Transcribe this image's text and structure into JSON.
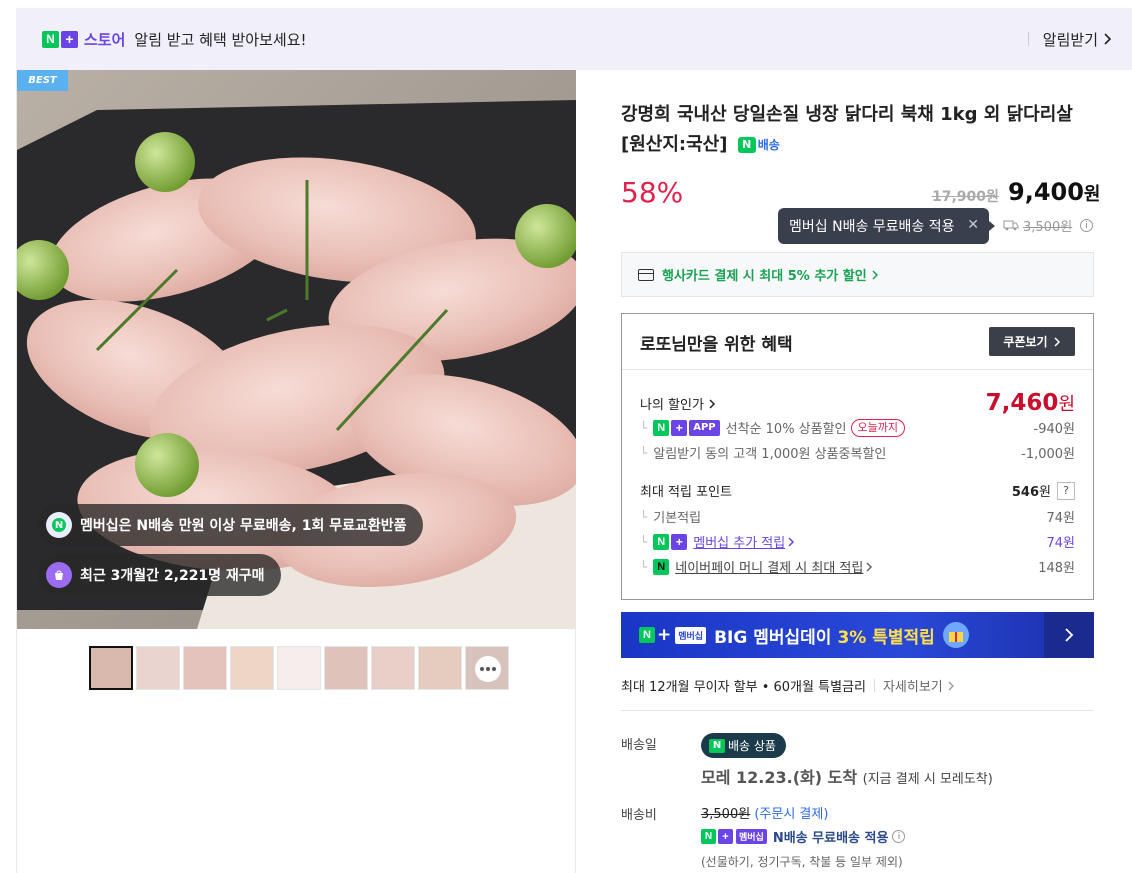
{
  "topbar": {
    "store_label": "스토어",
    "message": "알림 받고 혜택 받아보세요!",
    "notify_label": "알림받기"
  },
  "gallery": {
    "best_label": "BEST",
    "pill_membership": "멤버십은 N배송 만원 이상 무료배송, 1회 무료교환반품",
    "pill_repurchase": "최근 3개월간 2,221명 재구매",
    "thumb_count": 9
  },
  "product": {
    "title": "강명희 국내산 당일손질 냉장 닭다리 북채 1kg 외 닭다리살 [원산지:국산]",
    "delivery_badge": "배송",
    "discount_rate": "58%",
    "original_price": "17,900원",
    "price_value": "9,400",
    "price_unit": "원"
  },
  "tooltip": {
    "text": "멤버십 N배송 무료배송 적용"
  },
  "shipping_fee_strike": "3,500원",
  "card_promo": "행사카드 결제 시 최대 5% 추가 할인",
  "benefit": {
    "heading": "로또님만을 위한 혜택",
    "coupon_button": "쿠폰보기",
    "my_discount_label": "나의 할인가",
    "my_discount_value": "7,460",
    "my_discount_unit": "원",
    "app_label": "APP",
    "first_come_label": "선착순 10% 상품할인",
    "today_badge": "오늘까지",
    "first_come_value": "-940원",
    "notify_discount_label": "알림받기 동의 고객 1,000원 상품중복할인",
    "notify_discount_value": "-1,000원",
    "points_label": "최대 적립 포인트",
    "points_value": "546",
    "points_unit": "원",
    "points_help": "?",
    "basic_label": "기본적립",
    "basic_value": "74원",
    "membership_label": "멤버십 추가 적립",
    "membership_value": "74원",
    "naverpay_label": "네이버페이 머니 결제 시 최대 적립",
    "naverpay_value": "148원"
  },
  "banner": {
    "mem_tag": "멤버십",
    "text_main": "BIG 멤버십데이",
    "text_highlight": "3% 특별적립"
  },
  "installment": {
    "text": "최대 12개월 무이자 할부 • 60개월 특별금리",
    "more": "자세히보기"
  },
  "delivery": {
    "label": "배송일",
    "badge": "배송 상품",
    "arrive_main": "모레 12.23.(화) 도착",
    "arrive_sub": "(지금 결제 시 모레도착)",
    "fee_label": "배송비",
    "fee_strike": "3,500원",
    "fee_note": "(주문시 결제)",
    "mem_tag": "멤버십",
    "free_text": "N배송 무료배송 적용",
    "exclude_note": "(선물하기, 정기구독, 착불 등 일부 제외)"
  },
  "colors": {
    "accent_green": "#03c75a",
    "accent_purple": "#6b44e5",
    "discount_red": "#e0234b",
    "banner_blue": "#2a48d8"
  }
}
